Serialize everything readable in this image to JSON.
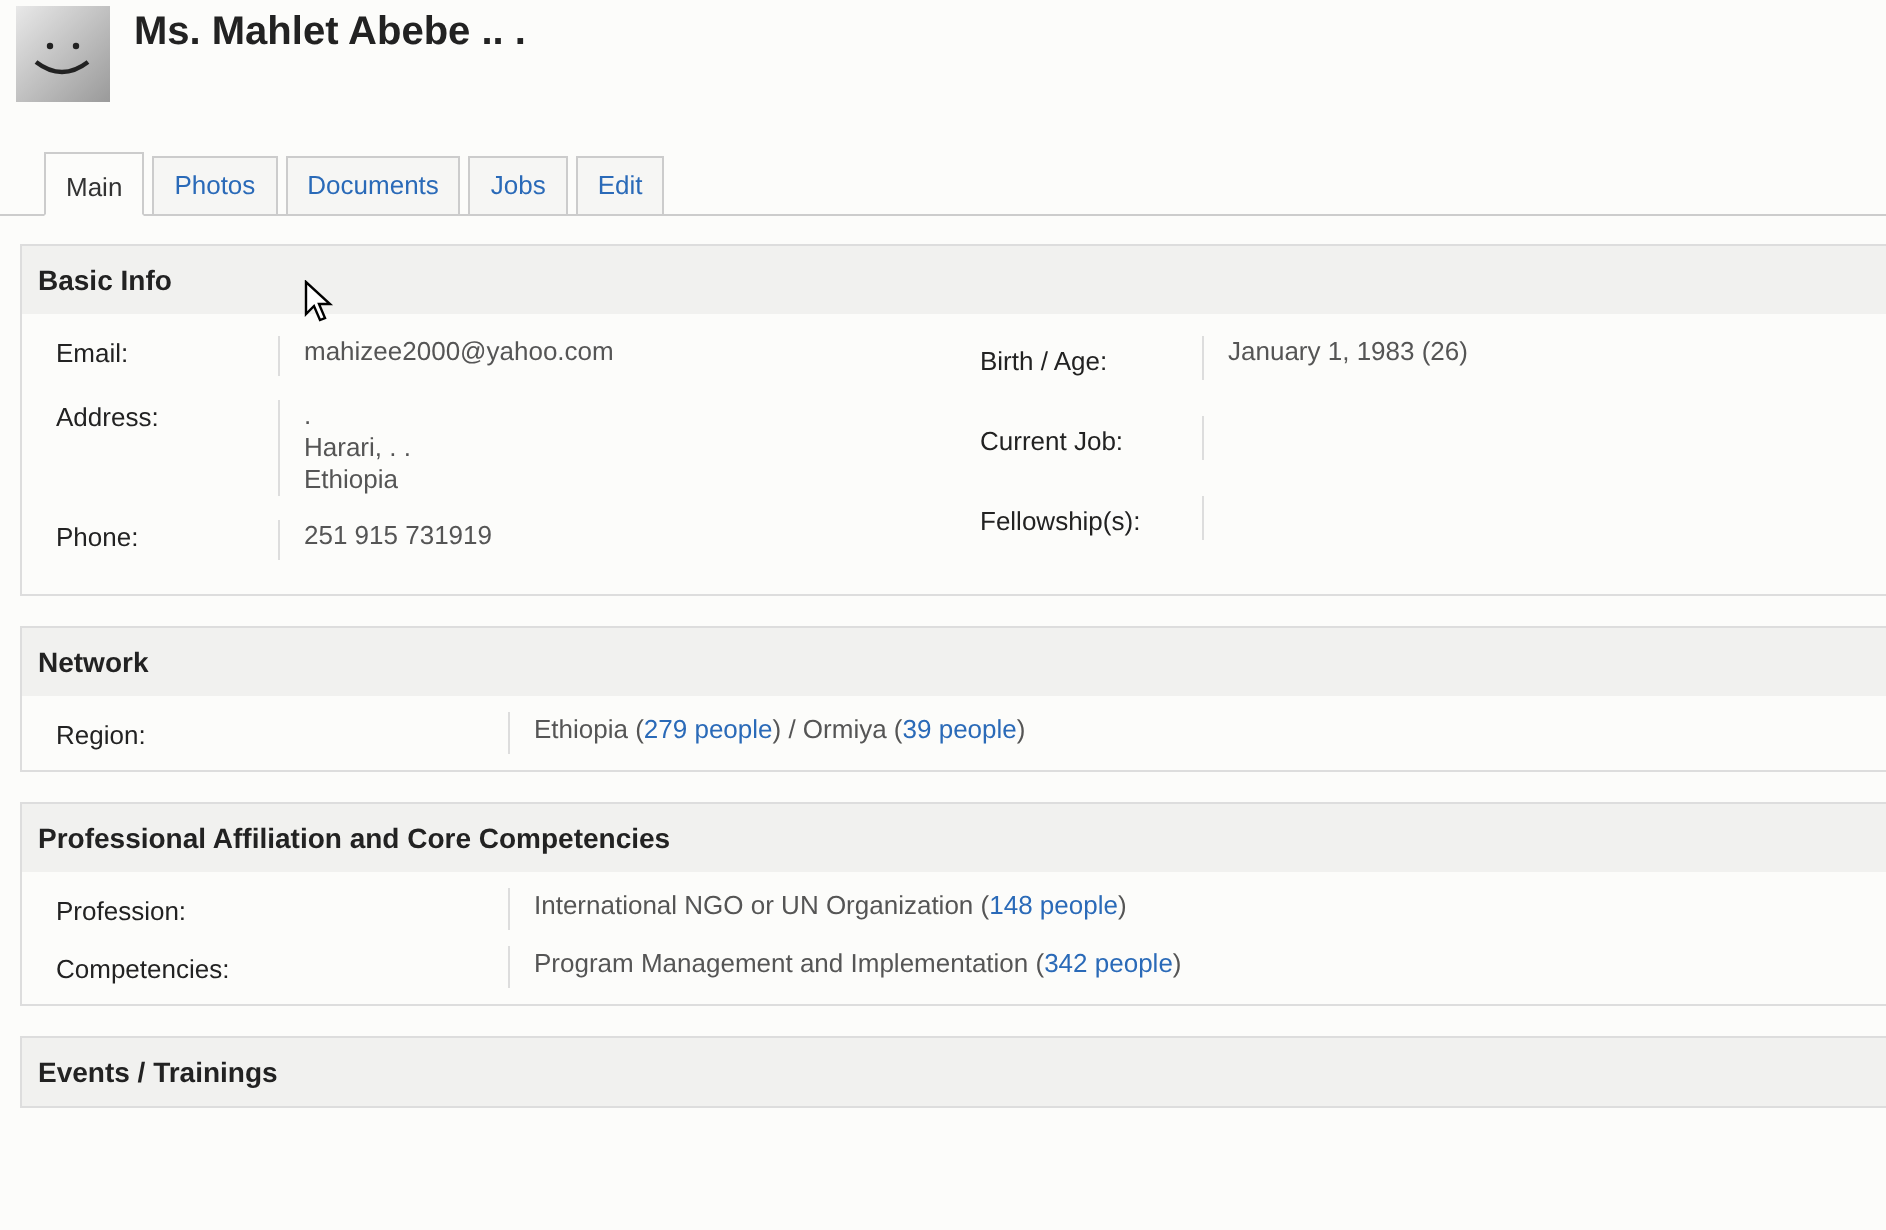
{
  "profile": {
    "name": "Ms. Mahlet Abebe .. ."
  },
  "tabs": [
    {
      "label": "Main",
      "selected": true
    },
    {
      "label": "Photos",
      "selected": false
    },
    {
      "label": "Documents",
      "selected": false
    },
    {
      "label": "Jobs",
      "selected": false
    },
    {
      "label": "Edit",
      "selected": false
    }
  ],
  "basic_info": {
    "title": "Basic Info",
    "left": [
      {
        "label": "Email:",
        "lines": [
          "mahizee2000@yahoo.com"
        ]
      },
      {
        "label": "Address:",
        "lines": [
          ".",
          "Harari, . .",
          "Ethiopia"
        ]
      },
      {
        "label": "Phone:",
        "lines": [
          "251 915 731919"
        ]
      }
    ],
    "right": [
      {
        "label": "Birth / Age:",
        "lines": [
          "January 1, 1983 (26)"
        ]
      },
      {
        "label": "Current Job:"
      },
      {
        "label": "Fellowship(s):"
      }
    ]
  },
  "sections": [
    {
      "title": "Network",
      "rows": [
        {
          "label": "Region:",
          "parts": [
            {
              "kind": "text",
              "text": "Ethiopia ("
            },
            {
              "kind": "link",
              "text": "279 people"
            },
            {
              "kind": "text",
              "text": ") / Ormiya ("
            },
            {
              "kind": "link",
              "text": "39 people"
            },
            {
              "kind": "text",
              "text": ")"
            }
          ]
        }
      ]
    },
    {
      "title": "Professional Affiliation and Core Competencies",
      "rows": [
        {
          "label": "Profession:",
          "parts": [
            {
              "kind": "text",
              "text": "International NGO or UN Organization ("
            },
            {
              "kind": "link",
              "text": "148 people"
            },
            {
              "kind": "text",
              "text": ")"
            }
          ]
        },
        {
          "label": "Competencies:",
          "parts": [
            {
              "kind": "text",
              "text": "Program Management and Implementation ("
            },
            {
              "kind": "link",
              "text": "342 people"
            },
            {
              "kind": "text",
              "text": ")"
            }
          ]
        }
      ]
    },
    {
      "title": "Events / Trainings"
    }
  ]
}
